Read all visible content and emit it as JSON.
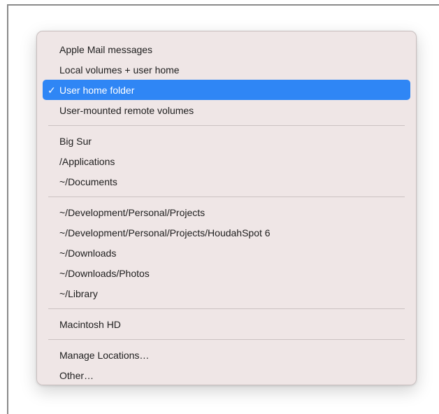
{
  "menu": {
    "groups": [
      {
        "items": [
          {
            "label": "Apple Mail messages"
          },
          {
            "label": "Local volumes + user home"
          },
          {
            "label": "User home folder",
            "checked": true
          },
          {
            "label": "User-mounted remote volumes"
          }
        ]
      },
      {
        "items": [
          {
            "label": "Big Sur"
          },
          {
            "label": "/Applications"
          },
          {
            "label": "~/Documents"
          }
        ]
      },
      {
        "items": [
          {
            "label": "~/Development/Personal/Projects"
          },
          {
            "label": "~/Development/Personal/Projects/HoudahSpot 6"
          },
          {
            "label": "~/Downloads"
          },
          {
            "label": "~/Downloads/Photos"
          },
          {
            "label": "~/Library"
          }
        ]
      },
      {
        "items": [
          {
            "label": "Macintosh HD"
          }
        ]
      },
      {
        "items": [
          {
            "label": "Manage Locations…"
          },
          {
            "label": "Other…"
          }
        ]
      }
    ],
    "check_glyph": "✓"
  },
  "colors": {
    "selection": "#2f86f5",
    "menu_background": "#eee4e4",
    "text": "#1e1e1e"
  },
  "icons": {
    "check": "checkmark-icon"
  }
}
